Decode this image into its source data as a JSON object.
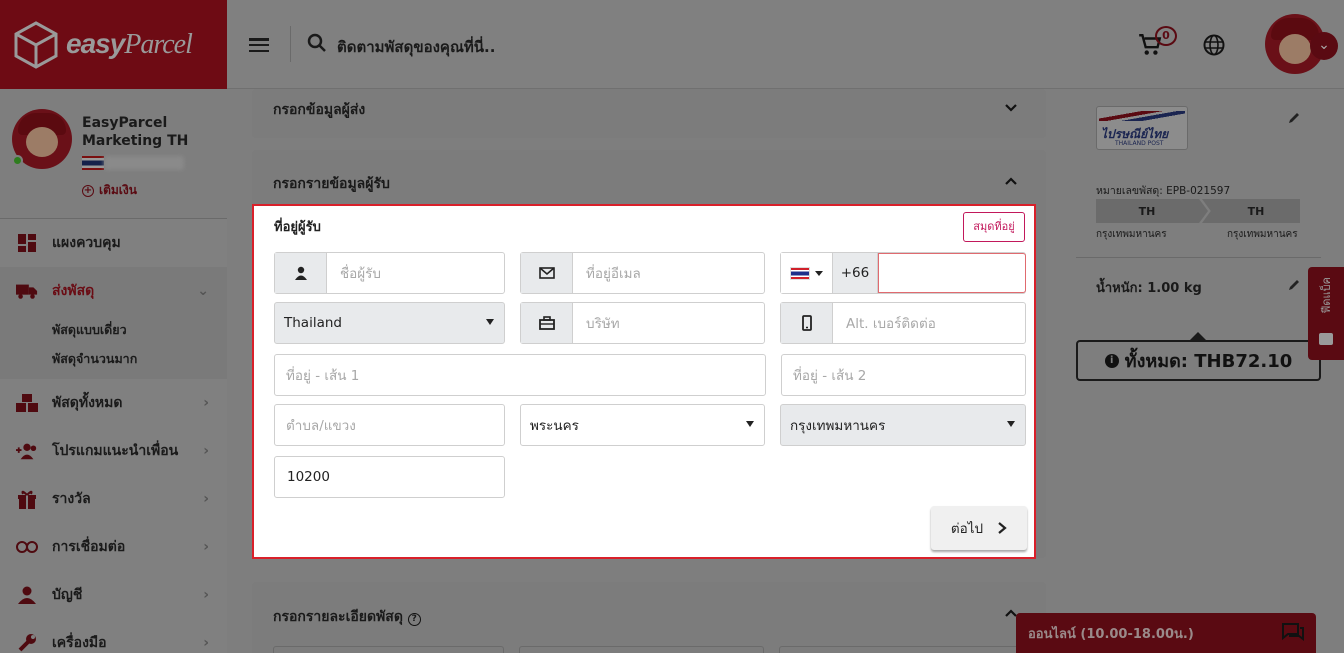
{
  "brand": {
    "name": "easy",
    "name2": "Parcel"
  },
  "topbar": {
    "search_placeholder": "ติดตามพัสดุของคุณที่นี่..",
    "cart_count": "0"
  },
  "profile": {
    "name": "EasyParcel Marketing TH",
    "topup": "เติมเงิน"
  },
  "sidebar": {
    "items": [
      {
        "label": "แผงควบคุม",
        "icon": "dashboard-icon"
      },
      {
        "label": "ส่งพัสดุ",
        "icon": "truck-icon"
      },
      {
        "label": "พัสดุทั้งหมด",
        "icon": "boxes-icon"
      },
      {
        "label": "โปรแกมแนะนำเพื่อน",
        "icon": "add-friend-icon"
      },
      {
        "label": "รางวัล",
        "icon": "gift-icon"
      },
      {
        "label": "การเชื่อมต่อ",
        "icon": "link-icon"
      },
      {
        "label": "บัญชี",
        "icon": "user-icon"
      },
      {
        "label": "เครื่องมือ",
        "icon": "wrench-icon"
      }
    ],
    "sub_items": [
      "พัสดุแบบเดี่ยว",
      "พัสดุจำนวนมาก"
    ]
  },
  "sections": {
    "sender": "กรอกข้อมูลผู้ส่ง",
    "receiver": "กรอกรายข้อมูลผู้รับ",
    "parcel": "กรอกรายละเอียดพัสดุ"
  },
  "form": {
    "title": "ที่อยู่ผู้รับ",
    "address_book": "สมุดที่อยู่",
    "name_ph": "ชื่อผู้รับ",
    "email_ph": "ที่อยู่อีเมล",
    "phone_code": "+66",
    "country": "Thailand",
    "company_ph": "บริษัท",
    "alt_phone_ph": "Alt. เบอร์ติดต่อ",
    "addr1_ph": "ที่อยู่ - เส้น 1",
    "addr2_ph": "ที่อยู่ - เส้น 2",
    "subdistrict_ph": "ตำบล/แขวง",
    "district": "พระนคร",
    "province": "กรุงเทพมหานคร",
    "postcode": "10200",
    "next": "ต่อไป"
  },
  "summary": {
    "courier": "ไปรษณีย์ไทย",
    "courier_sub": "THAILAND POST",
    "tracking": "หมายเลขพัสดุ: EPB-021597",
    "from": "TH",
    "to": "TH",
    "from_city": "กรุงเทพมหานคร",
    "to_city": "กรุงเทพมหานคร",
    "weight": "น้ำหนัก:  1.00 kg",
    "total": "ทั้งหมด: THB72.10"
  },
  "feedback": "ฟีดแบ็ค",
  "chat": "ออนไลน์ (10.00-18.00น.)"
}
